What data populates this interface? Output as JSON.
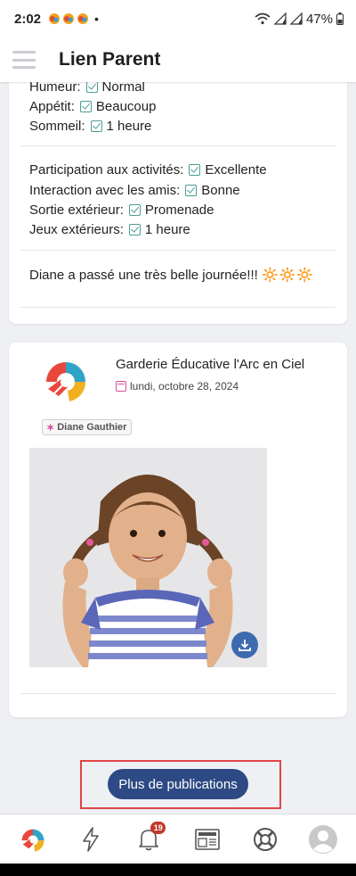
{
  "status_bar": {
    "time": "2:02",
    "dot": "•",
    "battery": "47%"
  },
  "app": {
    "title": "Lien Parent"
  },
  "card1": {
    "rows_top": [
      {
        "label": "Humeur:",
        "value": "Normal"
      },
      {
        "label": "Appétit:",
        "value": "Beaucoup"
      },
      {
        "label": "Sommeil:",
        "value": "1 heure"
      }
    ],
    "rows_mid": [
      {
        "label": "Participation aux activités:",
        "value": "Excellente"
      },
      {
        "label": "Interaction avec les amis:",
        "value": "Bonne"
      },
      {
        "label": "Sortie extérieur:",
        "value": "Promenade"
      },
      {
        "label": "Jeux extérieurs:",
        "value": "1 heure"
      }
    ],
    "note": "Diane a passé une très belle journée!!!",
    "note_emoji": "🔆🔆🔆"
  },
  "card2": {
    "org_name": "Garderie Éducative l'Arc en Ciel",
    "date": "lundi, octobre 28, 2024",
    "child_tag": "Diane Gauthier"
  },
  "more_button": {
    "label": "Plus de publications"
  },
  "bottom_nav": {
    "items": [
      {
        "icon": "app-logo-icon"
      },
      {
        "icon": "lightning-icon"
      },
      {
        "icon": "bell-icon",
        "badge": "19"
      },
      {
        "icon": "newspaper-icon"
      },
      {
        "icon": "lifebuoy-icon"
      },
      {
        "icon": "avatar-icon"
      }
    ]
  },
  "colors": {
    "accent": "#2e4a84",
    "check": "#4a9c95",
    "badge": "#c0392b",
    "tag_icon": "#d94a9c",
    "highlight": "#e04545"
  }
}
